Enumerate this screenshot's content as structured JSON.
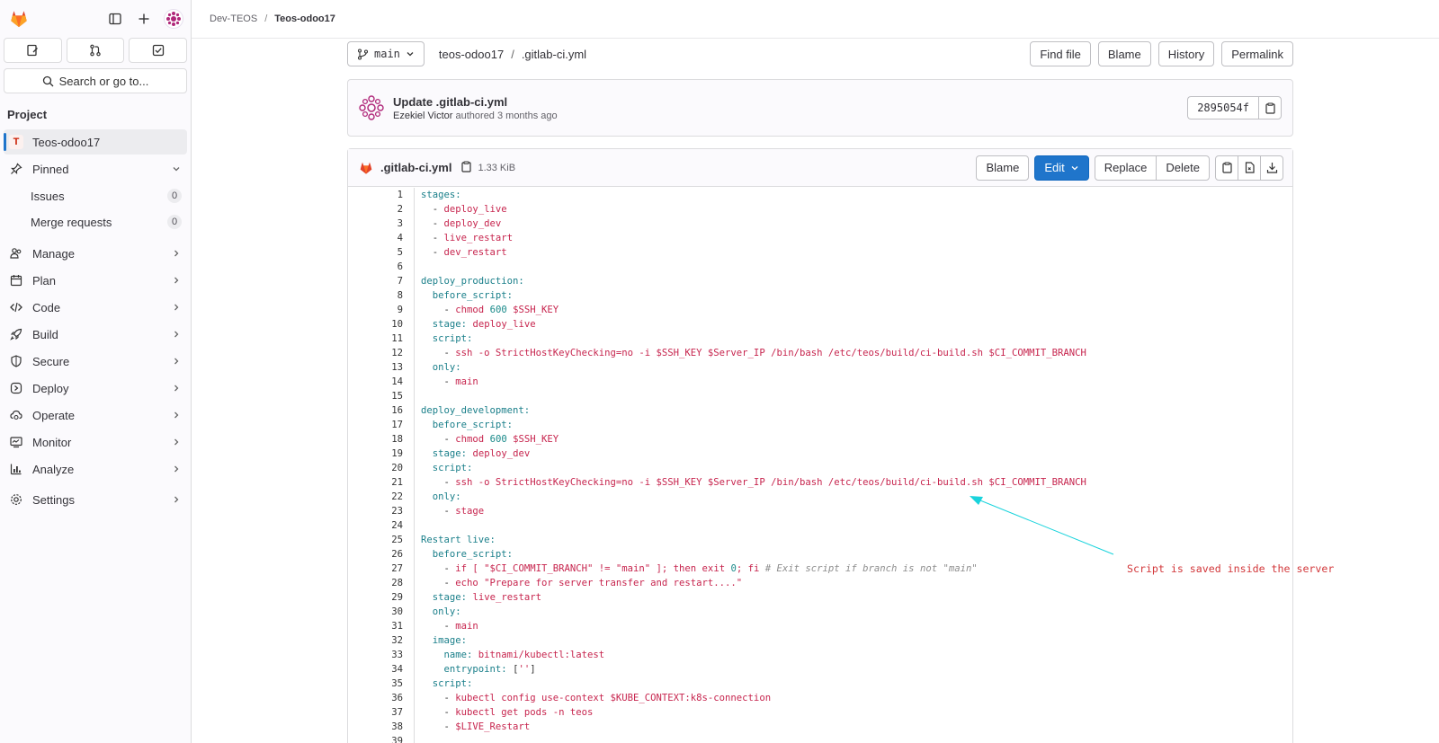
{
  "breadcrumb": {
    "group": "Dev-TEOS",
    "project": "Teos-odoo17"
  },
  "sidebar": {
    "search_label": "Search or go to...",
    "section_title": "Project",
    "project_item": {
      "initial": "T",
      "label": "Teos-odoo17"
    },
    "pinned_label": "Pinned",
    "pinned_items": [
      {
        "label": "Issues",
        "count": "0"
      },
      {
        "label": "Merge requests",
        "count": "0"
      }
    ],
    "nav_items": [
      {
        "label": "Manage",
        "icon": "users-icon"
      },
      {
        "label": "Plan",
        "icon": "calendar-icon"
      },
      {
        "label": "Code",
        "icon": "code-icon"
      },
      {
        "label": "Build",
        "icon": "rocket-icon"
      },
      {
        "label": "Secure",
        "icon": "shield-icon"
      },
      {
        "label": "Deploy",
        "icon": "deployments-icon"
      },
      {
        "label": "Operate",
        "icon": "cloud-gear-icon"
      },
      {
        "label": "Monitor",
        "icon": "monitor-icon"
      },
      {
        "label": "Analyze",
        "icon": "chart-icon"
      },
      {
        "label": "Settings",
        "icon": "settings-icon"
      }
    ]
  },
  "repo_nav": {
    "branch": "main",
    "path_root": "teos-odoo17",
    "path_file": ".gitlab-ci.yml",
    "actions": [
      "Find file",
      "Blame",
      "History",
      "Permalink"
    ]
  },
  "commit": {
    "title": "Update .gitlab-ci.yml",
    "author": "Ezekiel Victor",
    "meta": "authored 3 months ago",
    "sha": "2895054f"
  },
  "file": {
    "name": ".gitlab-ci.yml",
    "size": "1.33 KiB",
    "blame_label": "Blame",
    "edit_label": "Edit",
    "replace_label": "Replace",
    "delete_label": "Delete"
  },
  "annotation": "Script is saved inside the server",
  "colors": {
    "accent": "#1f75cb",
    "annotation": "#d2373a",
    "arrow": "#19d3dc"
  }
}
